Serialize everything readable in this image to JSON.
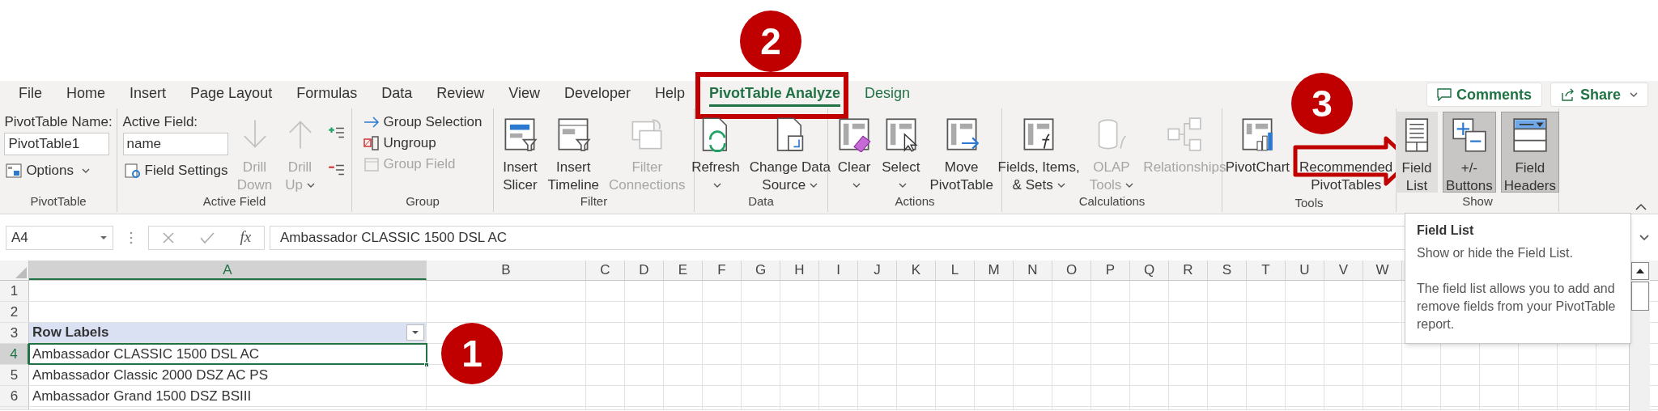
{
  "tabs": [
    {
      "label": "File",
      "kind": "standard",
      "selected": false
    },
    {
      "label": "Home",
      "kind": "standard",
      "selected": false
    },
    {
      "label": "Insert",
      "kind": "standard",
      "selected": false
    },
    {
      "label": "Page Layout",
      "kind": "standard",
      "selected": false
    },
    {
      "label": "Formulas",
      "kind": "standard",
      "selected": false
    },
    {
      "label": "Data",
      "kind": "standard",
      "selected": false
    },
    {
      "label": "Review",
      "kind": "standard",
      "selected": false
    },
    {
      "label": "View",
      "kind": "standard",
      "selected": false
    },
    {
      "label": "Developer",
      "kind": "standard",
      "selected": false
    },
    {
      "label": "Help",
      "kind": "standard",
      "selected": false
    },
    {
      "label": "PivotTable Analyze",
      "kind": "contextual",
      "selected": true
    },
    {
      "label": "Design",
      "kind": "contextual",
      "selected": false
    }
  ],
  "header_buttons": [
    {
      "label": "Comments",
      "dropdown": false
    },
    {
      "label": "Share",
      "dropdown": true
    }
  ],
  "ribbon_groups": [
    {
      "label": "PivotTable",
      "columns": [
        [
          {
            "kind": "field",
            "label": "PivotTable Name:",
            "value": "PivotTable1"
          },
          {
            "kind": "small",
            "label": "Options",
            "dropdown": true,
            "disabled": false
          }
        ]
      ]
    },
    {
      "label": "Active Field",
      "columns": [
        [
          {
            "kind": "field",
            "label": "Active Field:",
            "value": "name"
          },
          {
            "kind": "small",
            "label": "Field Settings",
            "dropdown": false,
            "disabled": false
          }
        ],
        [
          {
            "kind": "large",
            "lines": [
              "Drill",
              "Down"
            ],
            "dropdown": false,
            "disabled": true
          }
        ],
        [
          {
            "kind": "large",
            "lines": [
              "Drill",
              "Up"
            ],
            "dropdown": true,
            "disabled": true
          }
        ],
        [
          {
            "kind": "icon",
            "disabled": false
          },
          {
            "kind": "icon",
            "disabled": false
          }
        ]
      ]
    },
    {
      "label": "Group",
      "columns": [
        [
          {
            "kind": "small",
            "label": "Group Selection",
            "dropdown": false,
            "disabled": false
          },
          {
            "kind": "small",
            "label": "Ungroup",
            "dropdown": false,
            "disabled": false
          },
          {
            "kind": "small",
            "label": "Group Field",
            "dropdown": false,
            "disabled": true
          }
        ]
      ]
    },
    {
      "label": "Filter",
      "columns": [
        [
          {
            "kind": "large",
            "lines": [
              "Insert",
              "Slicer"
            ],
            "dropdown": false,
            "disabled": false
          }
        ],
        [
          {
            "kind": "large",
            "lines": [
              "Insert",
              "Timeline"
            ],
            "dropdown": false,
            "disabled": false
          }
        ],
        [
          {
            "kind": "large",
            "lines": [
              "Filter",
              "Connections"
            ],
            "dropdown": false,
            "disabled": true
          }
        ]
      ]
    },
    {
      "label": "Data",
      "columns": [
        [
          {
            "kind": "large",
            "lines": [
              "Refresh"
            ],
            "dropdown": true,
            "disabled": false
          }
        ],
        [
          {
            "kind": "large",
            "lines": [
              "Change Data",
              "Source"
            ],
            "dropdown": true,
            "disabled": false
          }
        ]
      ]
    },
    {
      "label": "Actions",
      "columns": [
        [
          {
            "kind": "large",
            "lines": [
              "Clear"
            ],
            "dropdown": true,
            "disabled": false
          }
        ],
        [
          {
            "kind": "large",
            "lines": [
              "Select"
            ],
            "dropdown": true,
            "disabled": false
          }
        ],
        [
          {
            "kind": "large",
            "lines": [
              "Move",
              "PivotTable"
            ],
            "dropdown": false,
            "disabled": false
          }
        ]
      ]
    },
    {
      "label": "Calculations",
      "columns": [
        [
          {
            "kind": "large",
            "lines": [
              "Fields, Items,",
              "& Sets"
            ],
            "dropdown": true,
            "disabled": false
          }
        ],
        [
          {
            "kind": "large",
            "lines": [
              "OLAP",
              "Tools"
            ],
            "dropdown": true,
            "disabled": true
          }
        ],
        [
          {
            "kind": "large",
            "lines": [
              "Relationships"
            ],
            "dropdown": false,
            "disabled": true
          }
        ]
      ]
    },
    {
      "label": "Tools",
      "columns": [
        [
          {
            "kind": "large",
            "lines": [
              "PivotChart"
            ],
            "dropdown": false,
            "disabled": false
          }
        ],
        [
          {
            "kind": "large",
            "lines": [
              "Recommended",
              "PivotTables"
            ],
            "dropdown": false,
            "disabled": false
          }
        ]
      ]
    },
    {
      "label": "Show",
      "columns": [
        [
          {
            "kind": "toggle",
            "lines": [
              "Field",
              "List"
            ],
            "pressed": false,
            "hovered": true
          }
        ],
        [
          {
            "kind": "toggle",
            "lines": [
              "+/-",
              "Buttons"
            ],
            "pressed": true,
            "hovered": false
          }
        ],
        [
          {
            "kind": "toggle",
            "lines": [
              "Field",
              "Headers"
            ],
            "pressed": true,
            "hovered": false
          }
        ]
      ]
    }
  ],
  "formula_bar": {
    "name_box": "A4",
    "fx_label": "fx",
    "content": "Ambassador CLASSIC 1500 DSL AC"
  },
  "columns": [
    {
      "label": "A",
      "selected": true
    },
    {
      "label": "B",
      "selected": false
    },
    {
      "label": "C",
      "selected": false
    },
    {
      "label": "D",
      "selected": false
    },
    {
      "label": "E",
      "selected": false
    },
    {
      "label": "F",
      "selected": false
    },
    {
      "label": "G",
      "selected": false
    },
    {
      "label": "H",
      "selected": false
    },
    {
      "label": "I",
      "selected": false
    },
    {
      "label": "J",
      "selected": false
    },
    {
      "label": "K",
      "selected": false
    },
    {
      "label": "L",
      "selected": false
    },
    {
      "label": "M",
      "selected": false
    },
    {
      "label": "N",
      "selected": false
    },
    {
      "label": "O",
      "selected": false
    },
    {
      "label": "P",
      "selected": false
    },
    {
      "label": "Q",
      "selected": false
    },
    {
      "label": "R",
      "selected": false
    },
    {
      "label": "S",
      "selected": false
    },
    {
      "label": "T",
      "selected": false
    },
    {
      "label": "U",
      "selected": false
    },
    {
      "label": "V",
      "selected": false
    },
    {
      "label": "W",
      "selected": false
    }
  ],
  "rows": [
    {
      "number": "1",
      "kind": "empty",
      "selected": false
    },
    {
      "number": "2",
      "kind": "empty",
      "selected": false
    },
    {
      "number": "3",
      "kind": "pivot-header",
      "value": "Row Labels",
      "selected": false
    },
    {
      "number": "4",
      "kind": "pivot-item",
      "value": "Ambassador CLASSIC 1500 DSL AC",
      "selected": true
    },
    {
      "number": "5",
      "kind": "pivot-item",
      "value": "Ambassador Classic 2000 DSZ AC PS",
      "selected": false
    },
    {
      "number": "6",
      "kind": "pivot-item",
      "value": "Ambassador Grand 1500 DSZ BSIII",
      "selected": false
    }
  ],
  "tooltip": {
    "title": "Field List",
    "description": "Show or hide the Field List.",
    "details": "The field list allows you to add and remove fields from your PivotTable report."
  },
  "step_badges": [
    {
      "number": "1"
    },
    {
      "number": "2"
    },
    {
      "number": "3"
    }
  ]
}
